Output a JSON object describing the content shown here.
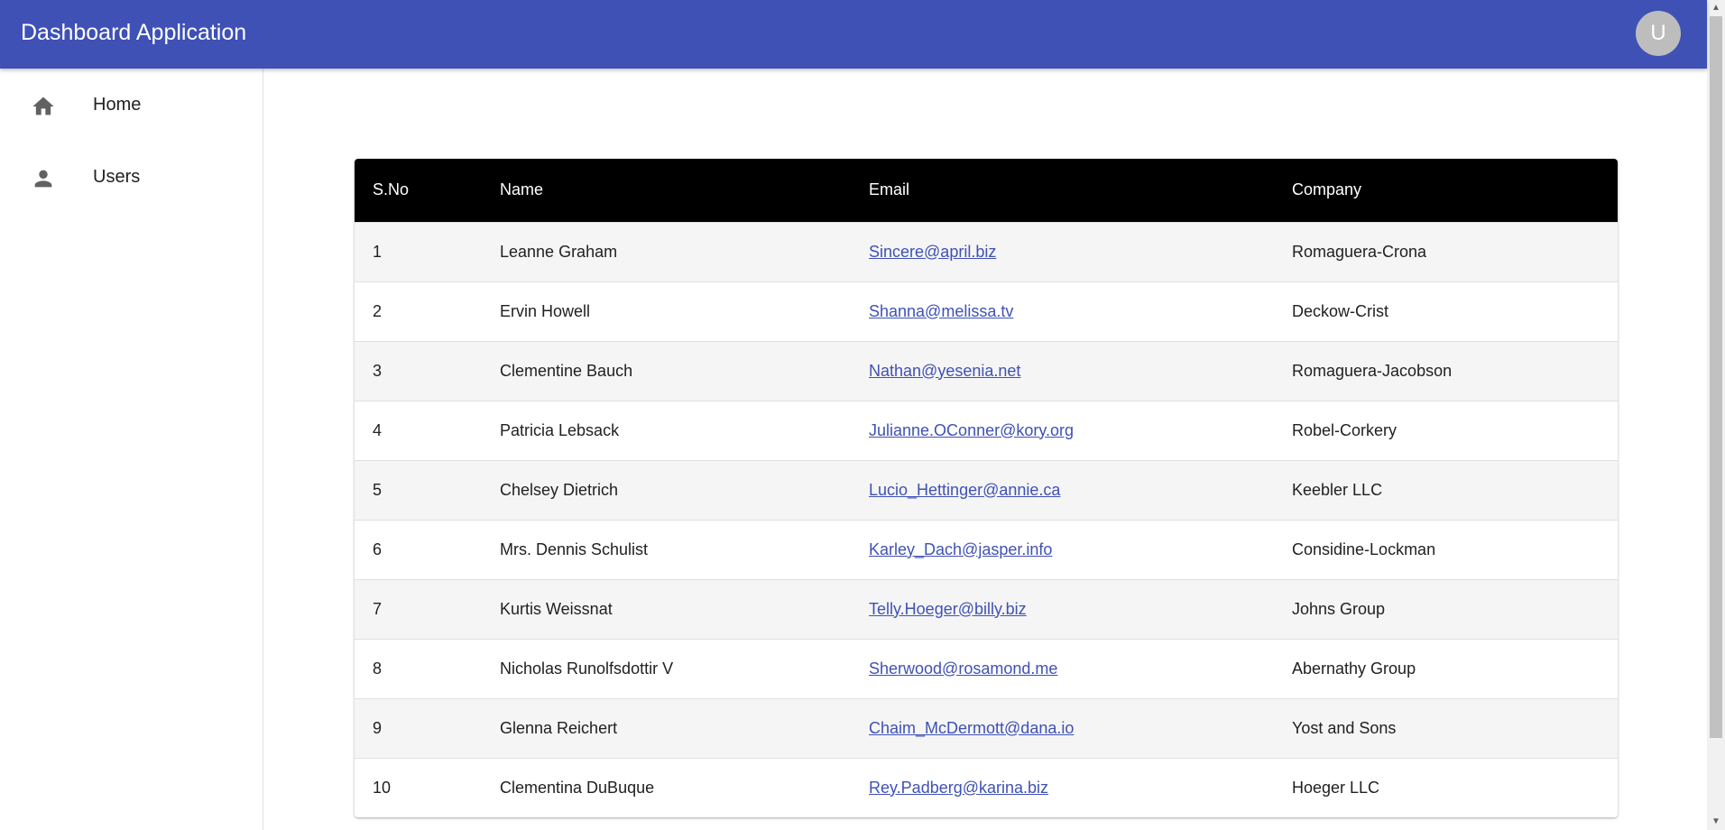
{
  "app": {
    "title": "Dashboard Application",
    "avatar_initial": "U"
  },
  "sidebar": {
    "items": [
      {
        "label": "Home",
        "icon": "home-icon"
      },
      {
        "label": "Users",
        "icon": "person-icon"
      }
    ]
  },
  "table": {
    "headers": [
      "S.No",
      "Name",
      "Email",
      "Company"
    ],
    "rows": [
      {
        "sno": "1",
        "name": "Leanne Graham",
        "email": "Sincere@april.biz",
        "company": "Romaguera-Crona"
      },
      {
        "sno": "2",
        "name": "Ervin Howell",
        "email": "Shanna@melissa.tv",
        "company": "Deckow-Crist"
      },
      {
        "sno": "3",
        "name": "Clementine Bauch",
        "email": "Nathan@yesenia.net",
        "company": "Romaguera-Jacobson"
      },
      {
        "sno": "4",
        "name": "Patricia Lebsack",
        "email": "Julianne.OConner@kory.org",
        "company": "Robel-Corkery"
      },
      {
        "sno": "5",
        "name": "Chelsey Dietrich",
        "email": "Lucio_Hettinger@annie.ca",
        "company": "Keebler LLC"
      },
      {
        "sno": "6",
        "name": "Mrs. Dennis Schulist",
        "email": "Karley_Dach@jasper.info",
        "company": "Considine-Lockman"
      },
      {
        "sno": "7",
        "name": "Kurtis Weissnat",
        "email": "Telly.Hoeger@billy.biz",
        "company": "Johns Group"
      },
      {
        "sno": "8",
        "name": "Nicholas Runolfsdottir V",
        "email": "Sherwood@rosamond.me",
        "company": "Abernathy Group"
      },
      {
        "sno": "9",
        "name": "Glenna Reichert",
        "email": "Chaim_McDermott@dana.io",
        "company": "Yost and Sons"
      },
      {
        "sno": "10",
        "name": "Clementina DuBuque",
        "email": "Rey.Padberg@karina.biz",
        "company": "Hoeger LLC"
      }
    ]
  },
  "colors": {
    "appbar": "#3f51b5",
    "table_header": "#000000",
    "link": "#3f51b5",
    "row_alt": "#f5f5f5"
  }
}
